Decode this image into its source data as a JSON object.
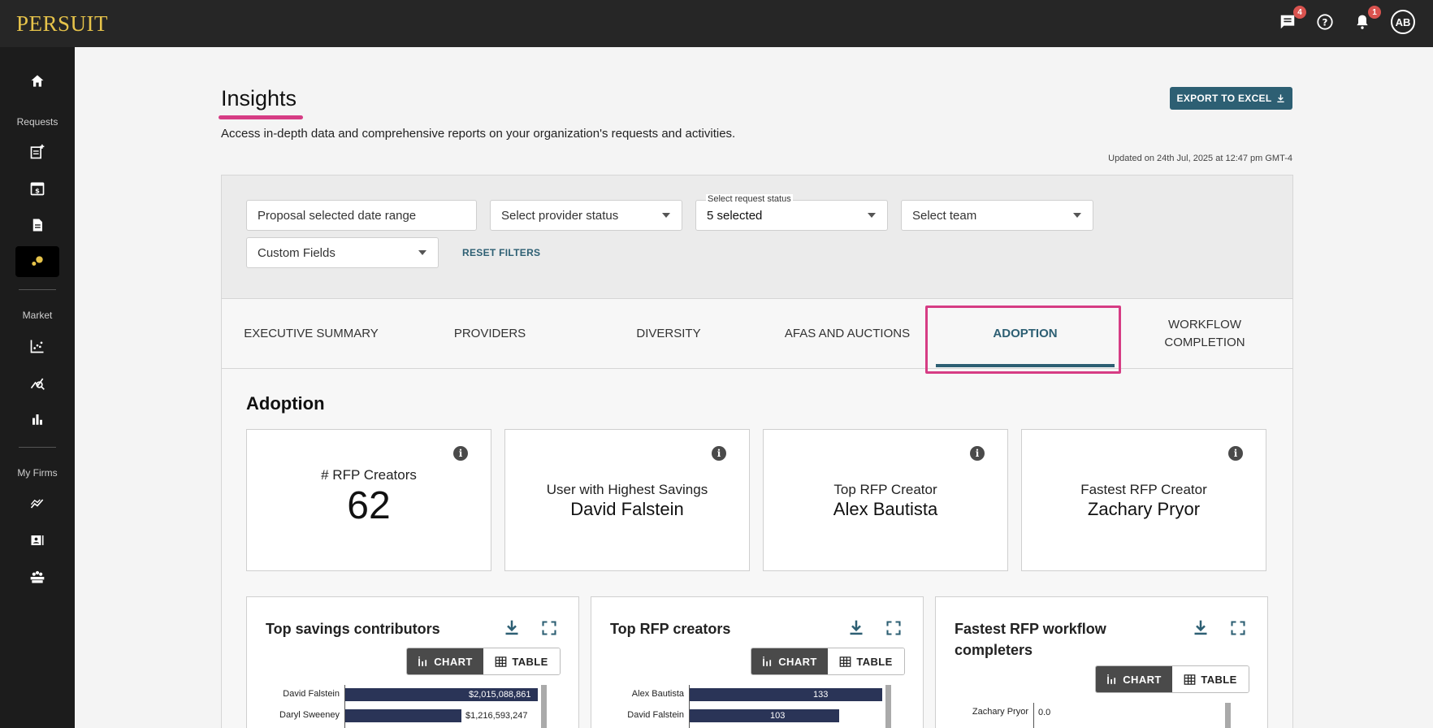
{
  "app": {
    "logo": "PERSUIT",
    "messages_badge": "4",
    "notifications_badge": "1",
    "avatar_initials": "AB"
  },
  "sidebar": {
    "section_requests": "Requests",
    "section_market": "Market",
    "section_my_firms": "My Firms"
  },
  "page": {
    "title": "Insights",
    "description": "Access in-depth data and comprehensive reports on your organization's requests and activities.",
    "export_label": "EXPORT TO EXCEL",
    "updated": "Updated on 24th Jul, 2025 at 12:47 pm GMT-4"
  },
  "filters": {
    "date_range": "Proposal selected date range",
    "provider_status": "Select provider status",
    "request_status_label": "Select request status",
    "request_status_value": "5 selected",
    "team": "Select team",
    "custom_fields": "Custom Fields",
    "reset": "RESET FILTERS"
  },
  "tabs": [
    {
      "label": "EXECUTIVE SUMMARY"
    },
    {
      "label": "PROVIDERS"
    },
    {
      "label": "DIVERSITY"
    },
    {
      "label": "AFAS AND AUCTIONS"
    },
    {
      "label": "ADOPTION"
    },
    {
      "label": "WORKFLOW COMPLETION"
    }
  ],
  "active_tab": "ADOPTION",
  "section": {
    "title": "Adoption"
  },
  "stats": [
    {
      "label": "# RFP Creators",
      "value": "62"
    },
    {
      "label": "User with Highest Savings",
      "value": "David Falstein"
    },
    {
      "label": "Top RFP Creator",
      "value": "Alex Bautista"
    },
    {
      "label": "Fastest RFP Creator",
      "value": "Zachary Pryor"
    }
  ],
  "toggle": {
    "chart": "CHART",
    "table": "TABLE"
  },
  "charts": [
    {
      "title": "Top savings contributors",
      "chart_data": {
        "type": "bar",
        "orientation": "horizontal",
        "categories": [
          "David Falstein",
          "Daryl Sweeney"
        ],
        "values": [
          2015088861,
          1216593247
        ],
        "value_labels": [
          "$2,015,088,861",
          "$1,216,593,247"
        ]
      }
    },
    {
      "title": "Top RFP creators",
      "chart_data": {
        "type": "bar",
        "orientation": "horizontal",
        "categories": [
          "Alex Bautista",
          "David Falstein"
        ],
        "values": [
          133,
          103
        ],
        "value_labels": [
          "133",
          "103"
        ]
      }
    },
    {
      "title": "Fastest RFP workflow completers",
      "chart_data": {
        "type": "bar",
        "orientation": "horizontal",
        "categories": [
          "Zachary Pryor"
        ],
        "values": [
          0.0
        ],
        "value_labels": [
          "0.0"
        ]
      }
    }
  ],
  "colors": {
    "accent": "#2d5f73",
    "highlight": "#d63c84",
    "bar": "#2a3457",
    "logo": "#e6c34a"
  }
}
